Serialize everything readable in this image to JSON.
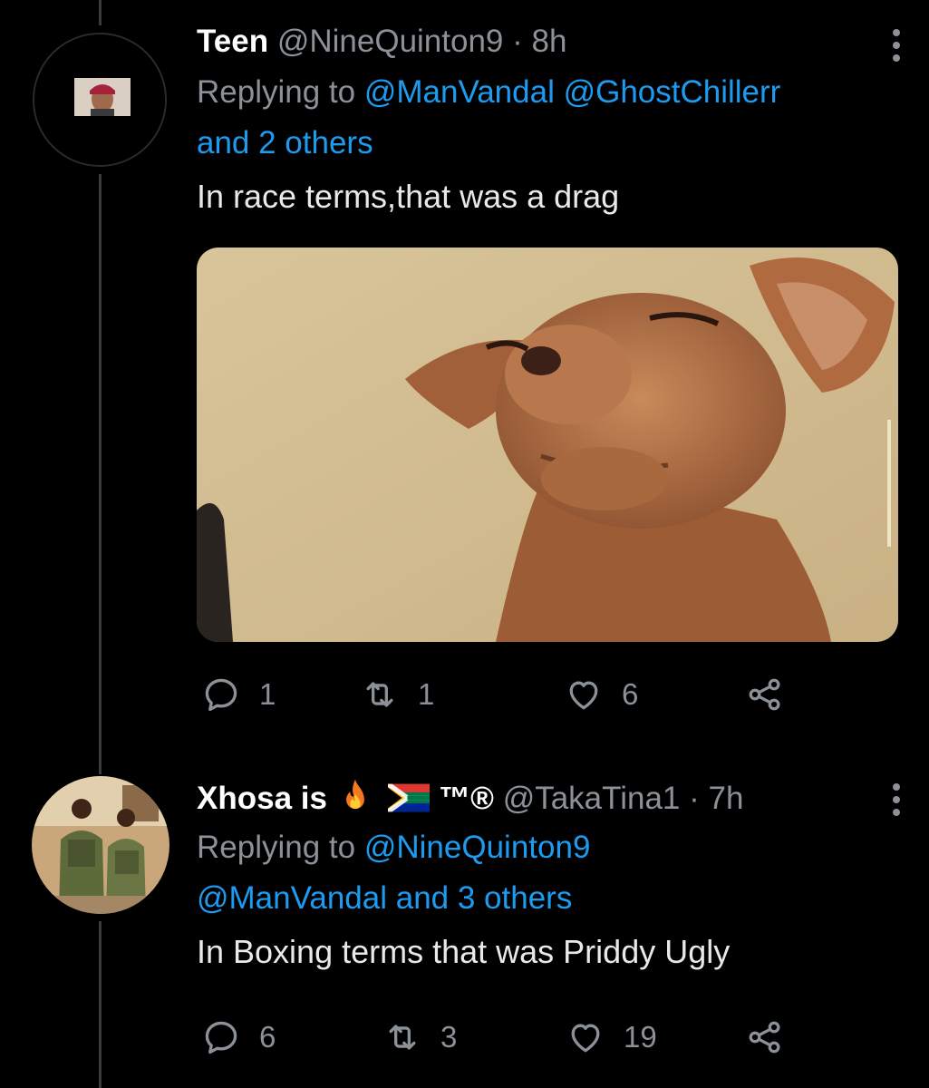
{
  "thread": {
    "tweets": [
      {
        "display_name": "Teen",
        "handle": "@NineQuinton9",
        "separator": "·",
        "time": "8h",
        "replying_prefix": "Replying to",
        "replying_to": [
          "@ManVandal",
          "@GhostChillerr"
        ],
        "replying_others": "and 2 others",
        "text": "In race terms,that was a drag",
        "media": {
          "kind": "photo",
          "subject": "chihuahua squinting"
        },
        "actions": {
          "reply_count": "1",
          "retweet_count": "1",
          "like_count": "6"
        },
        "icons": [
          "reply-icon",
          "retweet-icon",
          "like-icon",
          "share-icon",
          "more-icon"
        ]
      },
      {
        "display_name": "Xhosa is",
        "name_suffix": "™®",
        "emoji_icons": [
          "fire-emoji",
          "south-africa-flag-emoji"
        ],
        "handle": "@TakaTina1",
        "separator": "·",
        "time": "7h",
        "replying_prefix": "Replying to",
        "replying_to": [
          "@NineQuinton9",
          "@ManVandal"
        ],
        "replying_others": "and 3 others",
        "text": "In Boxing terms that was Priddy Ugly",
        "actions": {
          "reply_count": "6",
          "retweet_count": "3",
          "like_count": "19"
        }
      }
    ]
  },
  "colors": {
    "background": "#000000",
    "link": "#1d9bf0",
    "muted": "#8b9197",
    "text": "#e7e9ea",
    "thread_line": "#3a3b3d"
  }
}
